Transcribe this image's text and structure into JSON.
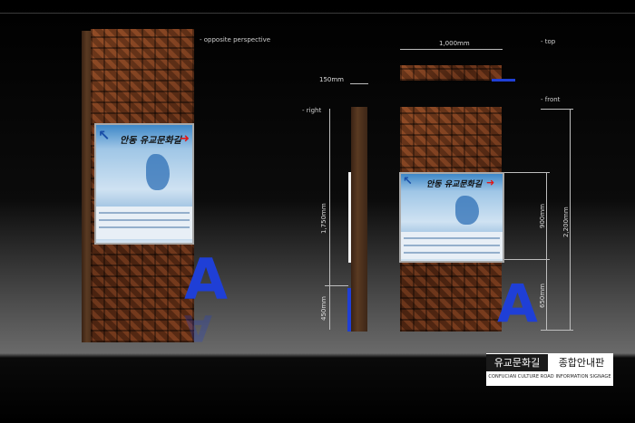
{
  "labels": {
    "opposite": "- opposite perspective",
    "top": "- top",
    "front": "- front",
    "right": "- right"
  },
  "dimensions": {
    "width_top": "1,000mm",
    "depth": "150mm",
    "height_side_upper": "1,750mm",
    "height_side_lower": "450mm",
    "panel_height": "900mm",
    "panel_base": "650mm",
    "total_height": "2,200mm"
  },
  "panel": {
    "title": "안동 유교문화길"
  },
  "caption": {
    "korean_main": "유교문화길",
    "korean_sub": "종합안내판",
    "english": "CONFUCIAN CULTURE ROAD INFORMATION SIGNAGE"
  },
  "colors": {
    "background": "#050505",
    "wood": "#6b3a1f",
    "panel_blue": "#3d87c7",
    "logo_blue": "#1f3fd6",
    "arrow_red": "#e01818"
  }
}
